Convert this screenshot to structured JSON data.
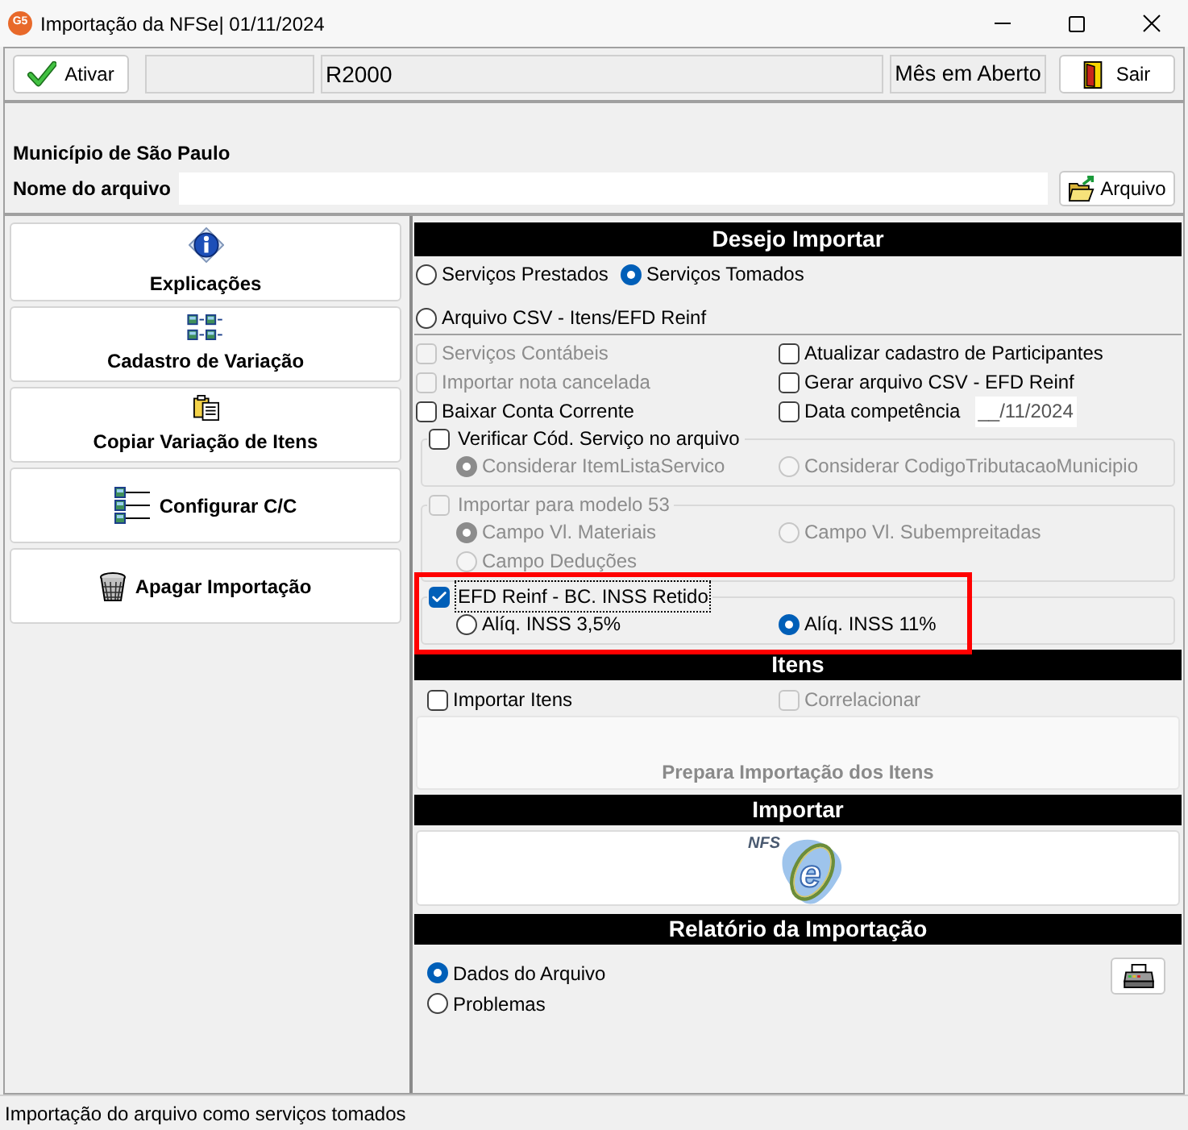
{
  "window": {
    "icon_text": "G5",
    "title": "Importação da NFSe| 01/11/2024"
  },
  "toolbar": {
    "activate_button": "Ativar",
    "code_field": "R2000",
    "period_field": "Mês em Aberto",
    "exit_button": "Sair"
  },
  "file_panel": {
    "municipality": "Município de São Paulo",
    "file_label": "Nome do arquivo",
    "browse_button": "Arquivo"
  },
  "side_menu": [
    {
      "kind": "info",
      "label": "Explicações"
    },
    {
      "kind": "variations",
      "label": "Cadastro de Variação"
    },
    {
      "kind": "copy",
      "label": "Copiar Variação de Itens"
    },
    {
      "kind": "list",
      "label": "Configurar C/C"
    },
    {
      "kind": "trash",
      "label": "Apagar Importação"
    }
  ],
  "import_section": {
    "title": "Desejo Importar",
    "source_options": [
      {
        "label": "Serviços Prestados",
        "selected": false
      },
      {
        "label": "Serviços Tomados",
        "selected": true
      },
      {
        "label": "Arquivo CSV - Itens/EFD Reinf",
        "selected": false
      }
    ],
    "options": [
      {
        "label": "Serviços Contábeis",
        "checked": false,
        "disabled": true
      },
      {
        "label": "Atualizar cadastro de Participantes",
        "checked": false,
        "disabled": false
      },
      {
        "label": "Importar nota cancelada",
        "checked": false,
        "disabled": true
      },
      {
        "label": "Gerar arquivo CSV - EFD Reinf",
        "checked": false,
        "disabled": false
      },
      {
        "label": "Baixar Conta Corrente",
        "checked": false,
        "disabled": false
      },
      {
        "label": "Data competência",
        "checked": false,
        "disabled": false,
        "date": "__/11/2024"
      }
    ],
    "groups": [
      {
        "label": "Verificar Cód. Serviço no arquivo",
        "checked": false,
        "disabled": false,
        "focused": false,
        "highlighted": false,
        "options": [
          {
            "label": "Considerar ItemListaServico",
            "selected": true,
            "disabled": true
          },
          {
            "label": "Considerar CodigoTributacaoMunicipio",
            "selected": false,
            "disabled": true
          }
        ]
      },
      {
        "label": "Importar para modelo 53",
        "checked": false,
        "disabled": true,
        "focused": false,
        "highlighted": false,
        "options": [
          {
            "label": "Campo Vl. Materiais",
            "selected": true,
            "disabled": true
          },
          {
            "label": "Campo Vl. Subempreitadas",
            "selected": false,
            "disabled": true
          },
          {
            "label": "Campo Deduções",
            "selected": false,
            "disabled": true
          }
        ]
      },
      {
        "label": "EFD Reinf - BC. INSS Retido",
        "checked": true,
        "disabled": false,
        "focused": true,
        "highlighted": true,
        "options": [
          {
            "label": "Alíq. INSS 3,5%",
            "selected": false,
            "disabled": false
          },
          {
            "label": "Alíq. INSS 11%",
            "selected": true,
            "disabled": false
          }
        ]
      }
    ]
  },
  "items_section": {
    "title": "Itens",
    "options": [
      {
        "label": "Importar Itens",
        "checked": false,
        "disabled": false
      },
      {
        "label": "Correlacionar",
        "checked": false,
        "disabled": true
      }
    ],
    "prepare_button": {
      "label": "Prepara Importação dos Itens",
      "disabled": true
    }
  },
  "run_section": {
    "title": "Importar",
    "logo": {
      "text": "NFS",
      "letter": "e"
    }
  },
  "report_section": {
    "title": "Relatório da Importação",
    "options": [
      {
        "label": "Dados do Arquivo",
        "selected": true
      },
      {
        "label": "Problemas",
        "selected": false
      }
    ]
  },
  "status_bar": "Importação do arquivo como serviços tomados"
}
